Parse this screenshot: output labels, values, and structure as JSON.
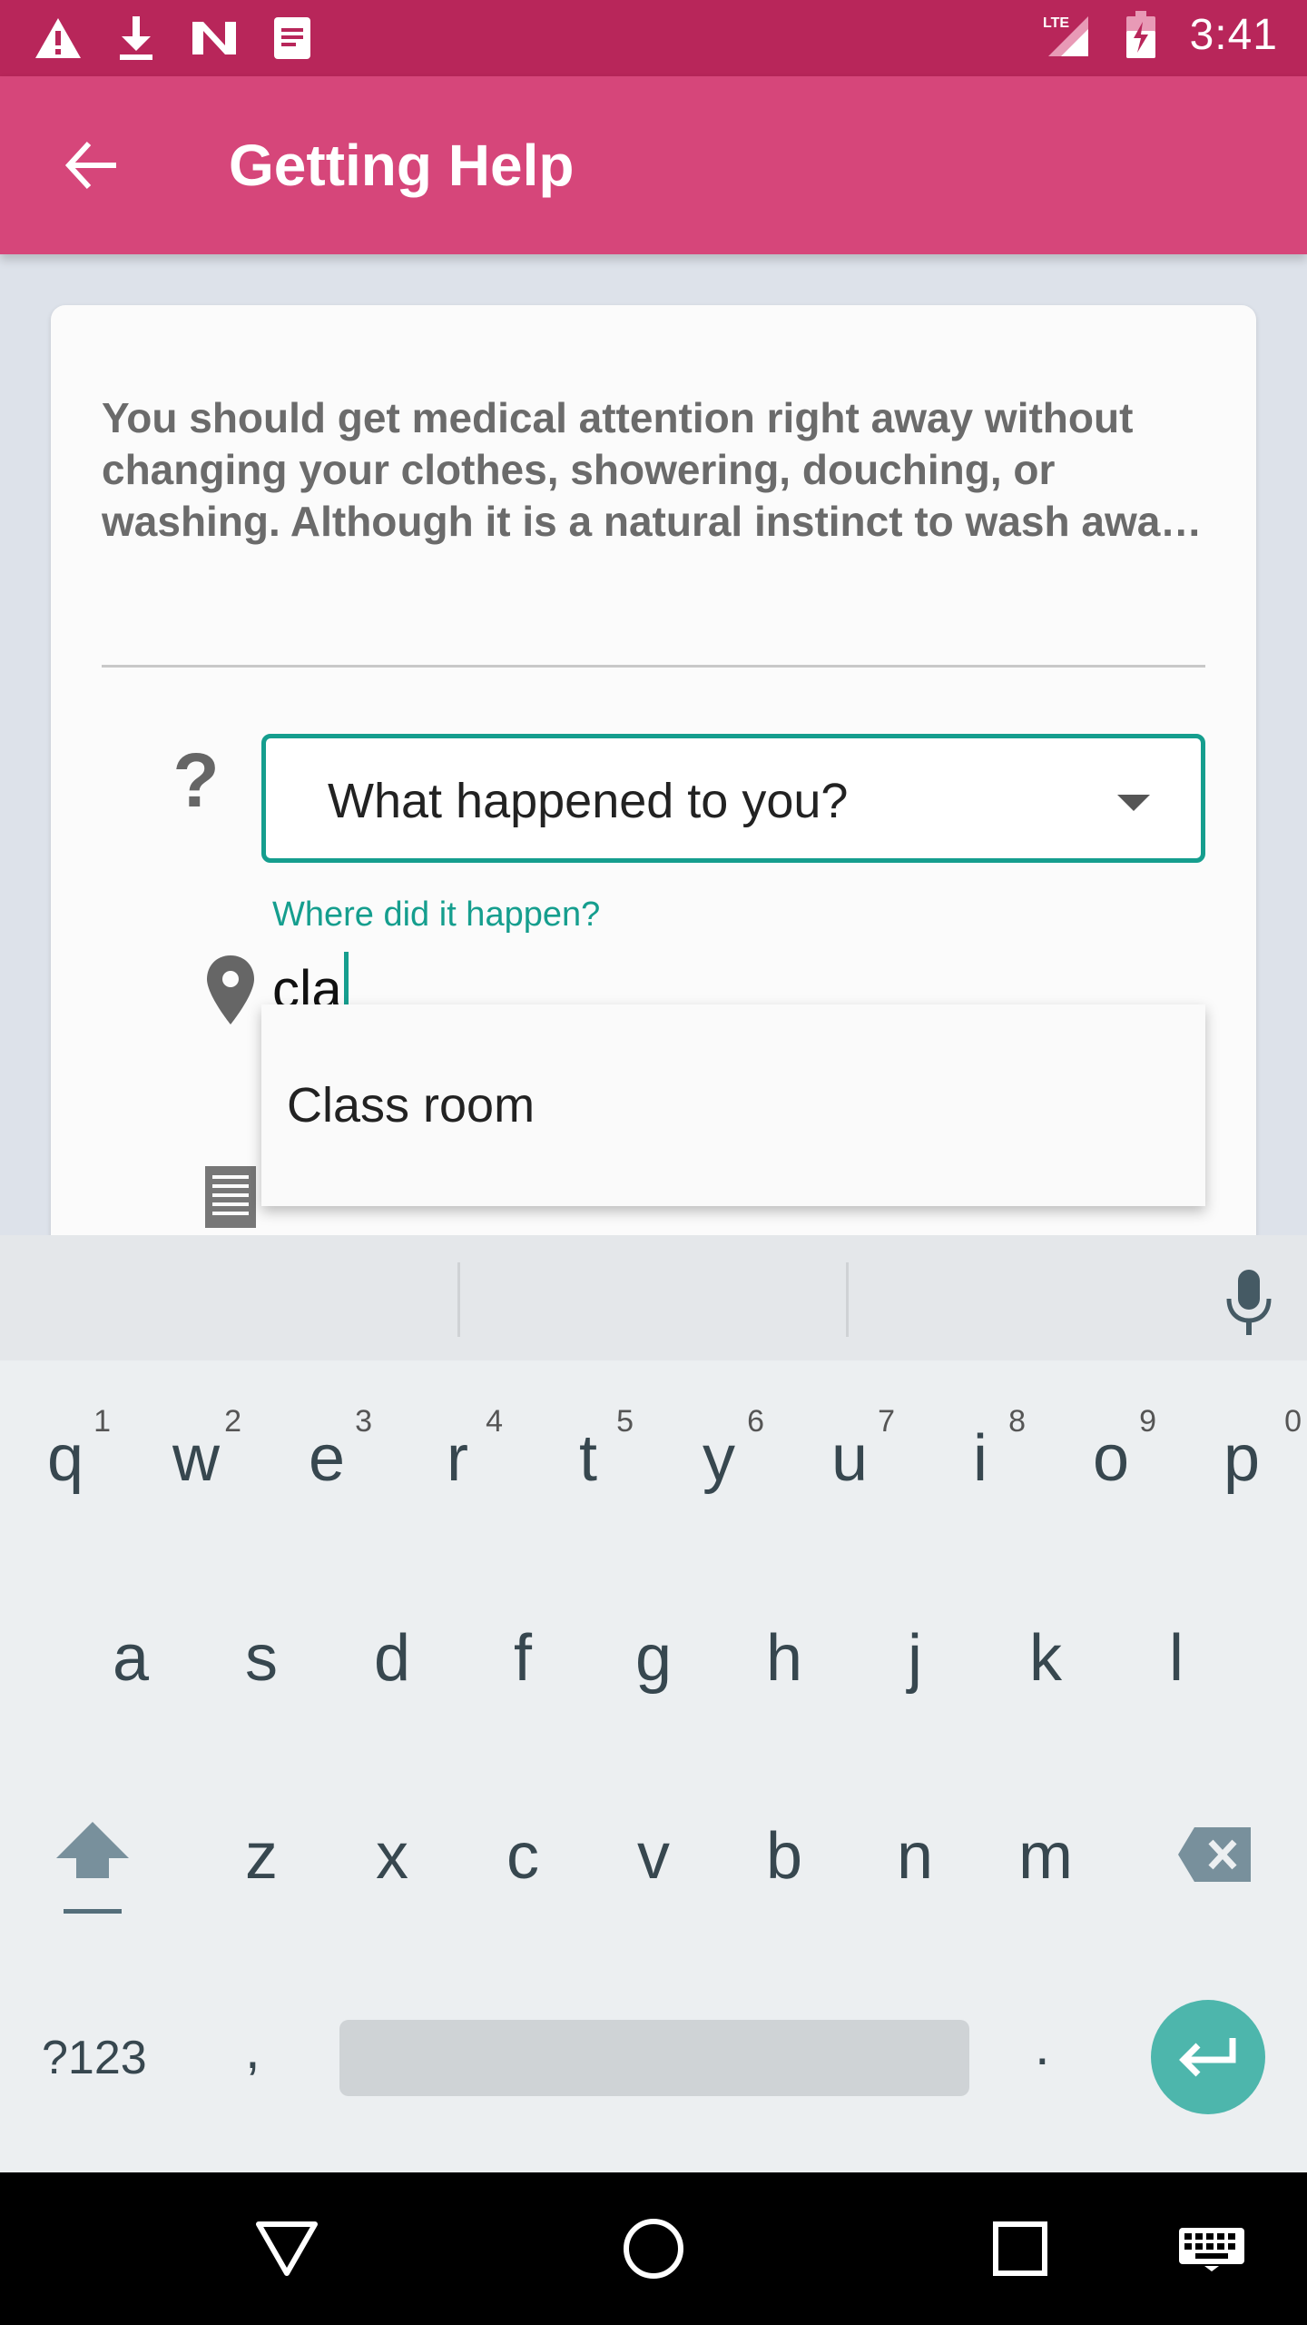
{
  "status_bar": {
    "time": "3:41",
    "network": "LTE",
    "icons": [
      "warning-icon",
      "download-icon",
      "n-logo-icon",
      "document-icon",
      "signal-icon",
      "battery-icon"
    ]
  },
  "app_bar": {
    "title": "Getting Help",
    "back_icon": "arrow-back-icon"
  },
  "card": {
    "paragraph": "You should get medical attention right away without changing your clothes, showering, douching, or washing. Although it is a natural instinct to wash awa…",
    "question_icon_glyph": "?",
    "dropdown_value": "What happened to you?",
    "location_label": "Where did it happen?",
    "location_value": "cla",
    "suggestions": [
      "Class room"
    ]
  },
  "keyboard": {
    "row1": [
      {
        "key": "q",
        "hint": "1"
      },
      {
        "key": "w",
        "hint": "2"
      },
      {
        "key": "e",
        "hint": "3"
      },
      {
        "key": "r",
        "hint": "4"
      },
      {
        "key": "t",
        "hint": "5"
      },
      {
        "key": "y",
        "hint": "6"
      },
      {
        "key": "u",
        "hint": "7"
      },
      {
        "key": "i",
        "hint": "8"
      },
      {
        "key": "o",
        "hint": "9"
      },
      {
        "key": "p",
        "hint": "0"
      }
    ],
    "row2": [
      "a",
      "s",
      "d",
      "f",
      "g",
      "h",
      "j",
      "k",
      "l"
    ],
    "row3": [
      "z",
      "x",
      "c",
      "v",
      "b",
      "n",
      "m"
    ],
    "symbols_label": "?123",
    "comma_label": ",",
    "period_label": "."
  },
  "colors": {
    "status_bar": "#b8265a",
    "app_bar": "#d6467a",
    "accent": "#159e8e",
    "enter_key": "#4db6ac"
  }
}
